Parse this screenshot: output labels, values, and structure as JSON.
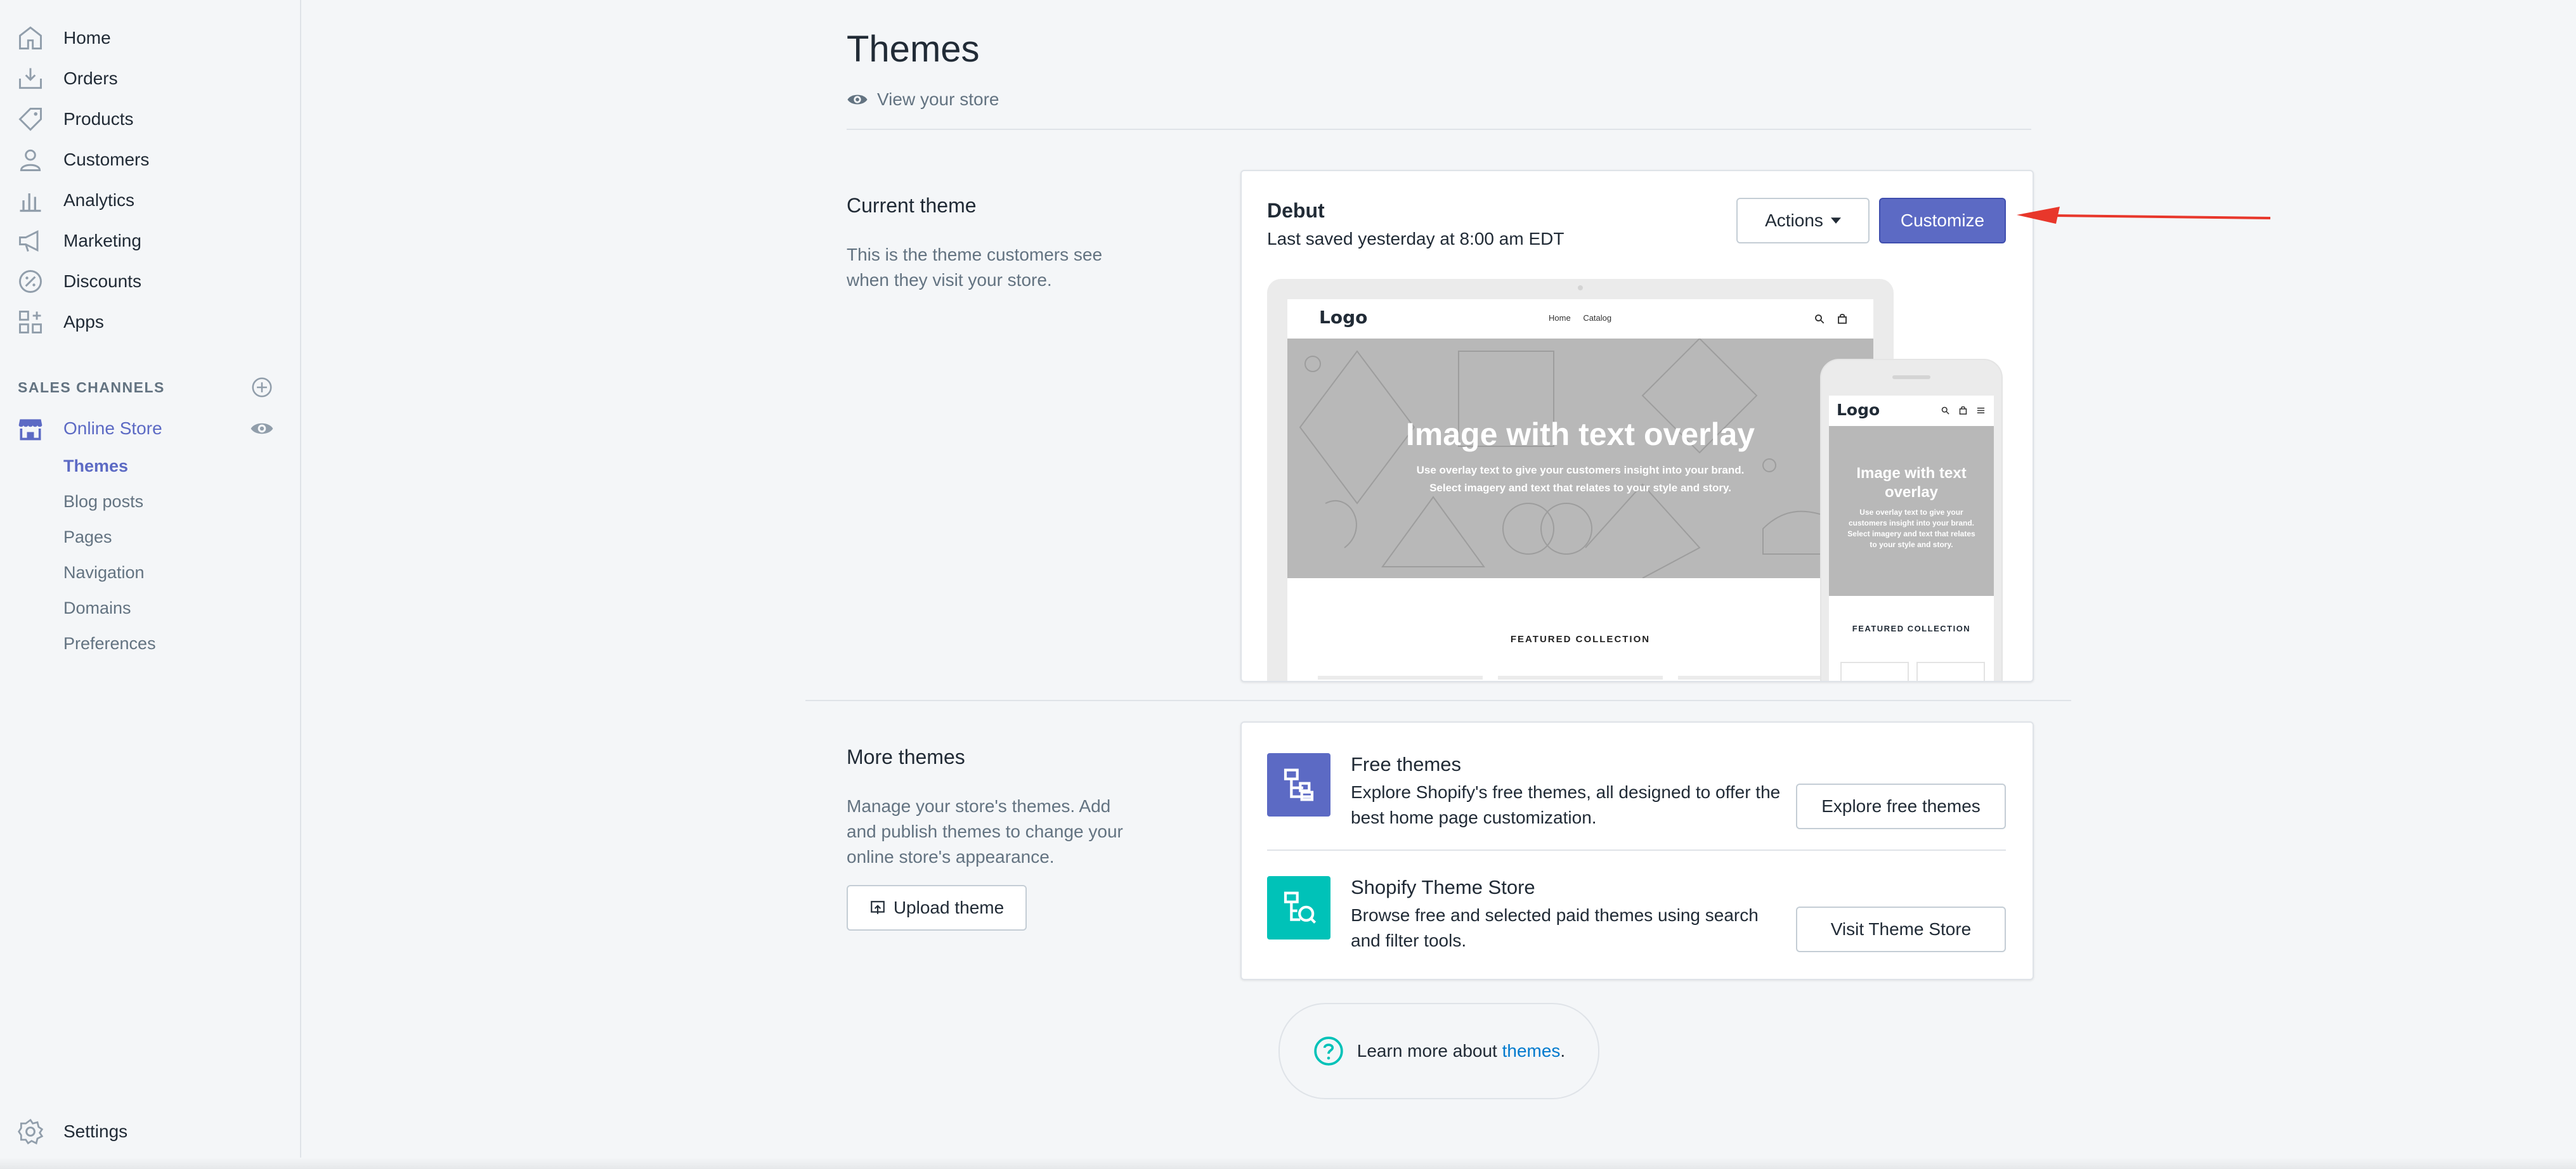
{
  "sidebar": {
    "items": [
      {
        "label": "Home",
        "icon": "home-icon"
      },
      {
        "label": "Orders",
        "icon": "orders-icon"
      },
      {
        "label": "Products",
        "icon": "tag-icon"
      },
      {
        "label": "Customers",
        "icon": "person-icon"
      },
      {
        "label": "Analytics",
        "icon": "bar-chart-icon"
      },
      {
        "label": "Marketing",
        "icon": "megaphone-icon"
      },
      {
        "label": "Discounts",
        "icon": "discount-icon"
      },
      {
        "label": "Apps",
        "icon": "apps-icon"
      }
    ],
    "section_label": "SALES CHANNELS",
    "channel": {
      "label": "Online Store"
    },
    "sub_items": [
      "Themes",
      "Blog posts",
      "Pages",
      "Navigation",
      "Domains",
      "Preferences"
    ],
    "settings_label": "Settings"
  },
  "header": {
    "title": "Themes",
    "view_store": "View your store"
  },
  "current_theme": {
    "section_title": "Current theme",
    "section_desc": "This is the theme customers see when they visit your store.",
    "name": "Debut",
    "saved": "Last saved yesterday at 8:00 am EDT",
    "actions_label": "Actions",
    "customize_label": "Customize",
    "preview": {
      "logo": "Logo",
      "nav_home": "Home",
      "nav_catalog": "Catalog",
      "hero_title": "Image with text overlay",
      "hero_sub_1": "Use overlay text to give your customers insight into your brand.",
      "hero_sub_2": "Select imagery and text that relates to your style and story.",
      "featured": "FEATURED COLLECTION",
      "mobile_hero_title_1": "Image with text",
      "mobile_hero_title_2": "overlay",
      "mobile_hero_sub_1": "Use overlay text to give your",
      "mobile_hero_sub_2": "customers insight into your brand.",
      "mobile_hero_sub_3": "Select imagery and text that relates",
      "mobile_hero_sub_4": "to your style and story."
    }
  },
  "more_themes": {
    "section_title": "More themes",
    "section_desc": "Manage your store's themes. Add and publish themes to change your online store's appearance.",
    "upload_label": "Upload theme",
    "rows": [
      {
        "title": "Free themes",
        "desc": "Explore Shopify's free themes, all designed to offer the best home page customization.",
        "button": "Explore free themes",
        "color": "#5c6ac4"
      },
      {
        "title": "Shopify Theme Store",
        "desc": "Browse free and selected paid themes using search and filter tools.",
        "button": "Visit Theme Store",
        "color": "#00c2b8"
      }
    ]
  },
  "learn_more": {
    "prefix": "Learn more about ",
    "link": "themes",
    "suffix": "."
  },
  "colors": {
    "accent": "#5c6ac4",
    "teal": "#00c2b8",
    "annotation_arrow": "#e8372b"
  }
}
